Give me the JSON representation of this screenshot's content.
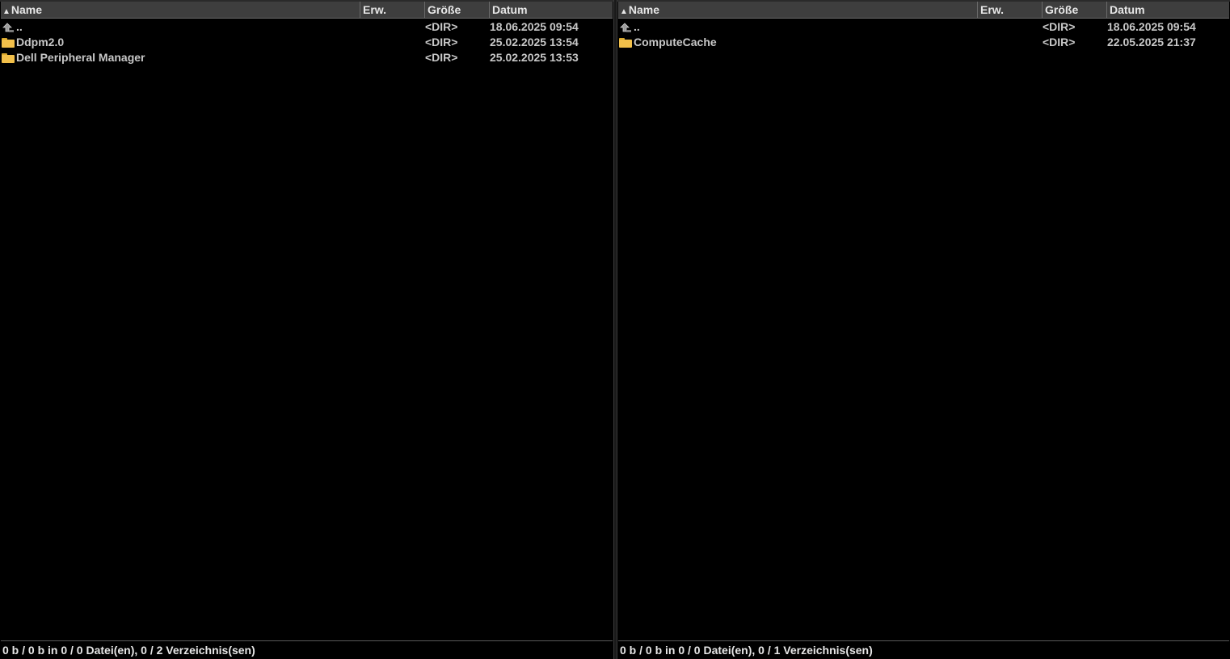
{
  "left_panel": {
    "columns": {
      "name": "Name",
      "ext": "Erw.",
      "size": "Größe",
      "date": "Datum"
    },
    "rows": [
      {
        "icon": "up-dir-icon",
        "name": "..",
        "size": "<DIR>",
        "date": "18.06.2025 09:54"
      },
      {
        "icon": "folder-icon",
        "name": "Ddpm2.0",
        "size": "<DIR>",
        "date": "25.02.2025 13:54"
      },
      {
        "icon": "folder-icon",
        "name": "Dell Peripheral Manager",
        "size": "<DIR>",
        "date": "25.02.2025 13:53"
      }
    ],
    "status": "0 b / 0 b in 0 / 0 Datei(en), 0 / 2 Verzeichnis(sen)"
  },
  "right_panel": {
    "columns": {
      "name": "Name",
      "ext": "Erw.",
      "size": "Größe",
      "date": "Datum"
    },
    "rows": [
      {
        "icon": "up-dir-icon",
        "name": "..",
        "size": "<DIR>",
        "date": "18.06.2025 09:54"
      },
      {
        "icon": "folder-icon",
        "name": "ComputeCache",
        "size": "<DIR>",
        "date": "22.05.2025 21:37"
      }
    ],
    "status": "0 b / 0 b in 0 / 0 Datei(en), 0 / 1 Verzeichnis(sen)"
  },
  "colors": {
    "background": "#000000",
    "header_bg": "#3e3e3e",
    "text": "#c8c8c8",
    "folder": "#f2c04a"
  }
}
